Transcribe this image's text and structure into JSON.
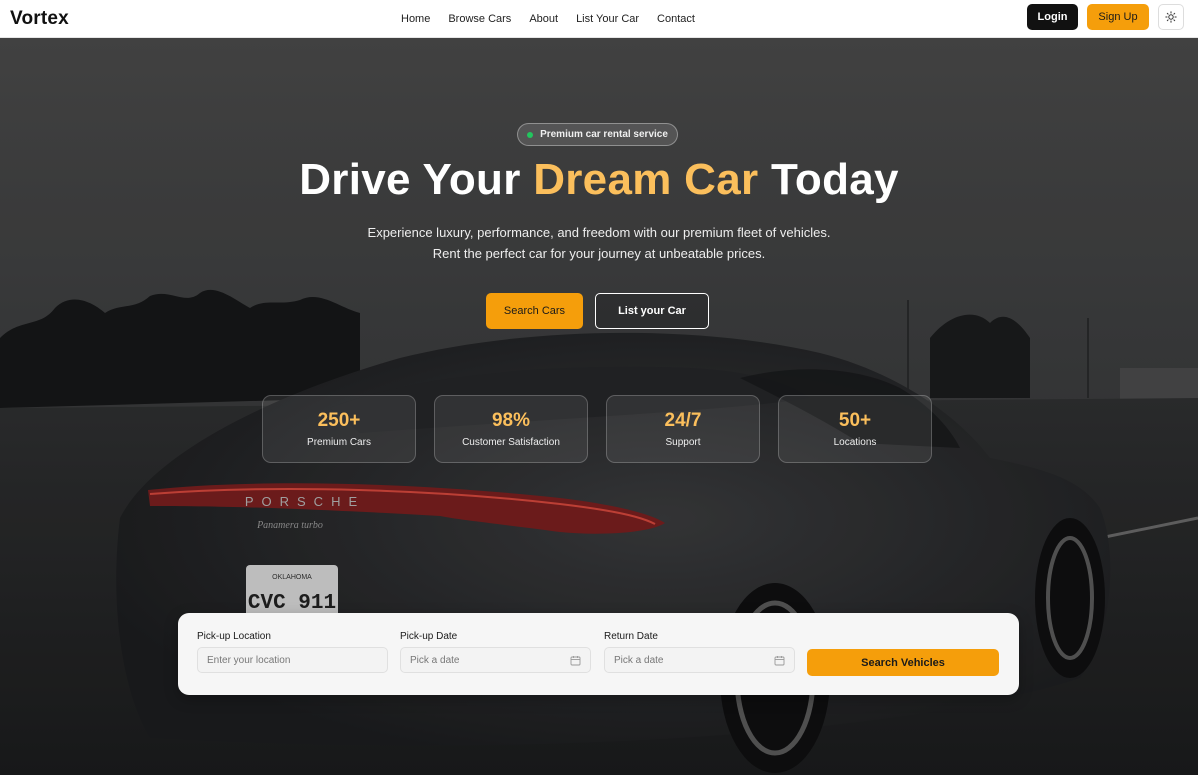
{
  "nav": {
    "brand": "Vortex",
    "links": [
      "Home",
      "Browse Cars",
      "About",
      "List Your Car",
      "Contact"
    ],
    "login_label": "Login",
    "signup_label": "Sign Up",
    "theme_icon": "sun-icon"
  },
  "hero": {
    "badge": "Premium car rental service",
    "headline_start": "Drive Your ",
    "headline_accent": "Dream Car",
    "headline_end": " Today",
    "sub_line1": "Experience luxury, performance, and freedom with our premium fleet of vehicles.",
    "sub_line2": "Rent the perfect car for your journey at unbeatable prices.",
    "search_cars_label": "Search Cars",
    "list_car_label": "List your Car",
    "car_brand_lettering": "PORSCHE",
    "car_model_lettering": "Panamera turbo",
    "plate_state": "OKLAHOMA",
    "plate_text": "CVC 911"
  },
  "stats": [
    {
      "value": "250+",
      "label": "Premium Cars"
    },
    {
      "value": "98%",
      "label": "Customer Satisfaction"
    },
    {
      "value": "24/7",
      "label": "Support"
    },
    {
      "value": "50+",
      "label": "Locations"
    }
  ],
  "search": {
    "pickup_location_label": "Pick-up Location",
    "pickup_location_placeholder": "Enter your location",
    "pickup_date_label": "Pick-up Date",
    "pickup_date_placeholder": "Pick a date",
    "return_date_label": "Return Date",
    "return_date_placeholder": "Pick a date",
    "submit_label": "Search Vehicles",
    "calendar_icon": "calendar-icon"
  },
  "colors": {
    "accent": "#f59e0b",
    "accent_text": "#fbbf5c",
    "status_dot": "#22c55e",
    "dark_button": "#111111"
  }
}
